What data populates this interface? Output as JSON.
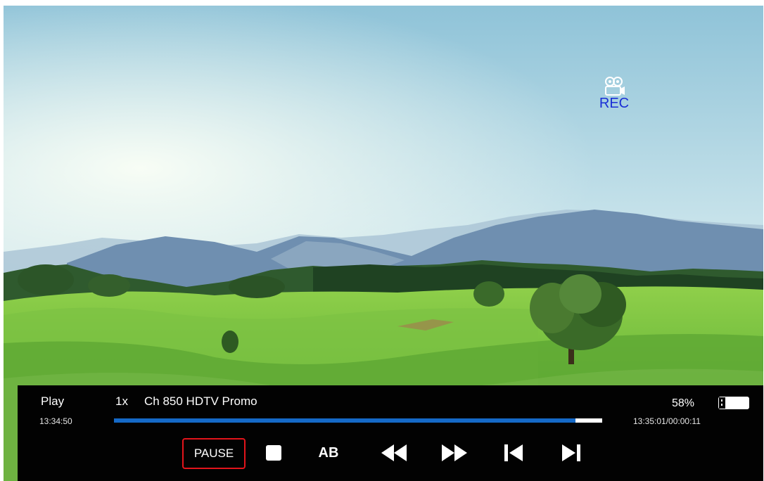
{
  "rec": {
    "label": "REC",
    "icon": "video-camera-icon",
    "color": "#1a2fd6"
  },
  "bar": {
    "mode": "Play",
    "current_time": "13:34:50",
    "speed": "1x",
    "channel": "Ch 850 HDTV Promo",
    "percent": "58%",
    "end_time": "13:35:01/00:00:11",
    "progress": 0.945,
    "progress_color": "#1569c7"
  },
  "controls": {
    "pause_label": "PAUSE",
    "stop_icon": "stop-icon",
    "ab_label": "AB",
    "rewind_icon": "rewind-icon",
    "fast_forward_icon": "fast-forward-icon",
    "previous_icon": "skip-previous-icon",
    "next_icon": "skip-next-icon",
    "selected_border_color": "#e3141b"
  }
}
